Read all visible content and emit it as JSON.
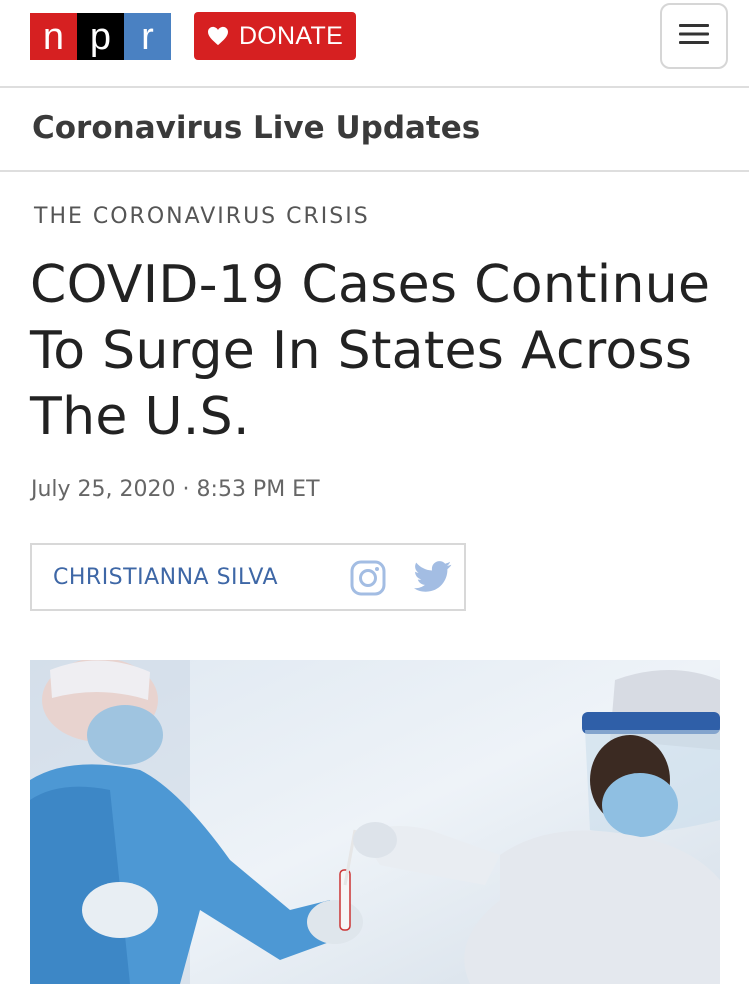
{
  "header": {
    "logo": {
      "letters": [
        "n",
        "p",
        "r"
      ],
      "colors": [
        "#d62021",
        "#000000",
        "#4a81c2"
      ]
    },
    "donate_label": "DONATE",
    "donate_icon": "heart-icon",
    "menu_icon": "hamburger-menu-icon"
  },
  "section": {
    "title": "Coronavirus Live Updates"
  },
  "article": {
    "slug": "THE CORONAVIRUS CRISIS",
    "headline": "COVID-19 Cases Continue To Surge In States Across The U.S.",
    "date": "July 25, 2020",
    "separator": "·",
    "time": "8:53 PM ET",
    "author": "CHRISTIANNA SILVA",
    "author_icons": [
      "instagram-icon",
      "twitter-icon"
    ]
  },
  "colors": {
    "brand_red": "#d62021",
    "link_blue": "#3e67a6",
    "icon_blue": "#a3bde3"
  },
  "image": {
    "subject": "photo"
  }
}
